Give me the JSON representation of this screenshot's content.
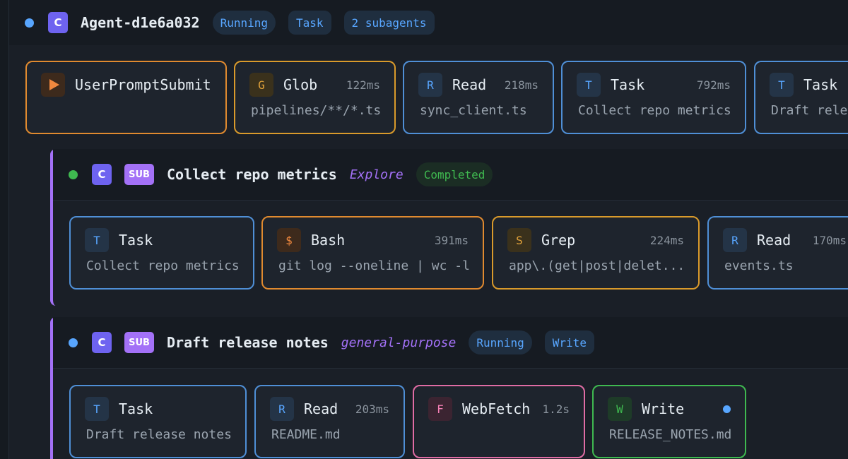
{
  "agent": {
    "badge_letter": "C",
    "title": "Agent-d1e6a032",
    "status": "Running",
    "current_tool": "Task",
    "subagent_count": "2 subagents"
  },
  "main_events": [
    {
      "icon": "play-icon",
      "name": "UserPromptSubmit",
      "duration": "",
      "detail": ""
    },
    {
      "icon": "G",
      "name": "Glob",
      "duration": "122ms",
      "detail": "pipelines/**/*.ts"
    },
    {
      "icon": "R",
      "name": "Read",
      "duration": "218ms",
      "detail": "sync_client.ts"
    },
    {
      "icon": "T",
      "name": "Task",
      "duration": "792ms",
      "detail": "Collect repo metrics"
    },
    {
      "icon": "T",
      "name": "Task",
      "duration": "",
      "detail": "Draft release notes"
    }
  ],
  "subagents": [
    {
      "badge_letter": "C",
      "sub_label": "SUB",
      "title": "Collect repo metrics",
      "type": "Explore",
      "status": "Completed",
      "events": [
        {
          "icon": "T",
          "name": "Task",
          "duration": "",
          "detail": "Collect repo metrics"
        },
        {
          "icon": "$",
          "name": "Bash",
          "duration": "391ms",
          "detail": "git log --oneline | wc -l"
        },
        {
          "icon": "S",
          "name": "Grep",
          "duration": "224ms",
          "detail": "app\\.(get|post|delet..."
        },
        {
          "icon": "R",
          "name": "Read",
          "duration": "170ms",
          "detail": "events.ts"
        }
      ]
    },
    {
      "badge_letter": "C",
      "sub_label": "SUB",
      "title": "Draft release notes",
      "type": "general-purpose",
      "status": "Running",
      "current_tool": "Write",
      "events": [
        {
          "icon": "T",
          "name": "Task",
          "duration": "",
          "detail": "Draft release notes"
        },
        {
          "icon": "R",
          "name": "Read",
          "duration": "203ms",
          "detail": "README.md"
        },
        {
          "icon": "F",
          "name": "WebFetch",
          "duration": "1.2s",
          "detail": ""
        },
        {
          "icon": "W",
          "name": "Write",
          "duration": "",
          "detail": "RELEASE_NOTES.md"
        }
      ]
    }
  ]
}
